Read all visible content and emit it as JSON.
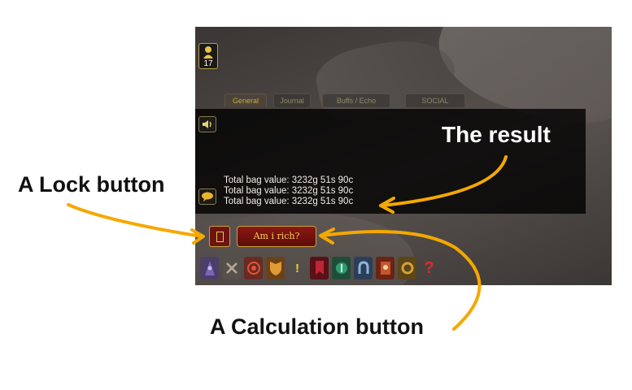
{
  "character": {
    "level": "17",
    "icon": "character-portrait-icon"
  },
  "chat": {
    "tabs": [
      "General",
      "Journal",
      "Buffs / Echo",
      "SOCIAL"
    ],
    "lines": [
      "Total bag value: 3232g 51s 90c",
      "Total bag value: 3232g 51s 90c",
      "Total bag value: 3232g 51s 90c"
    ],
    "speaker_icon": "speaker-icon",
    "bubble_icon": "chat-bubble-icon"
  },
  "buttons": {
    "lock_icon": "lock-icon",
    "calculate_label": "Am i rich?"
  },
  "action_bar": [
    {
      "icon": "mage-icon",
      "color": "#6c5a9c"
    },
    {
      "icon": "crossed-tools-icon",
      "color": "#6c645d"
    },
    {
      "icon": "target-icon",
      "color": "#b83a2a"
    },
    {
      "icon": "shield-icon",
      "color": "#d08a2a"
    },
    {
      "icon": "exclamation-icon",
      "color": "#e2c530"
    },
    {
      "icon": "banner-icon",
      "color": "#9e1f2b"
    },
    {
      "icon": "pvp-icon",
      "color": "#2f9c6b"
    },
    {
      "icon": "horseshoe-icon",
      "color": "#5b7aa4"
    },
    {
      "icon": "journal-icon",
      "color": "#b14022"
    },
    {
      "icon": "wow-logo-icon",
      "color": "#d1a23a"
    },
    {
      "icon": "help-icon",
      "color": "#cc2222"
    }
  ],
  "annotations": {
    "lock": "A Lock button",
    "result": "The result",
    "calculation": "A Calculation button"
  },
  "colors": {
    "arrow": "#f5a800",
    "button_red": "#6e1410",
    "button_gold": "#c9a13a"
  }
}
